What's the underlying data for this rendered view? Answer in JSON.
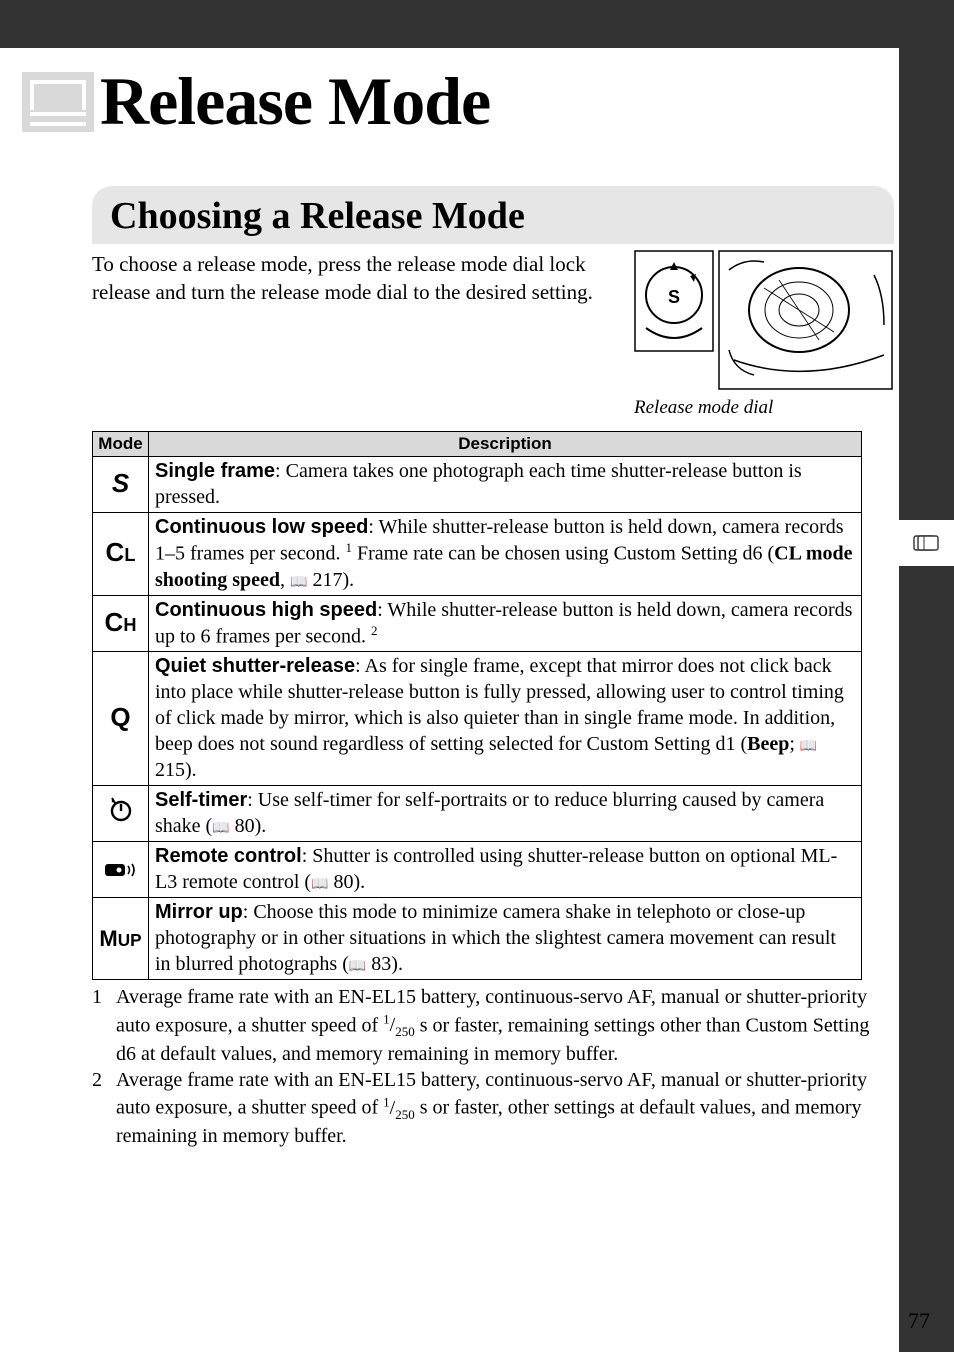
{
  "chapter": {
    "title": "Release Mode"
  },
  "section": {
    "heading": "Choosing a Release Mode"
  },
  "intro": "To choose a release mode, press the release mode dial lock release and turn the release mode dial to the desired setting.",
  "diagram_caption": "Release mode dial",
  "table": {
    "headers": {
      "mode": "Mode",
      "description": "Description"
    },
    "rows": [
      {
        "mode_label": "S",
        "mode_class": "mode-s",
        "desc_lead": "Single frame",
        "desc_rest": ": Camera takes one photograph each time shutter-release button is pressed."
      },
      {
        "mode_label": "CL",
        "mode_class": "mode-cl",
        "desc_lead": "Continuous low speed",
        "desc_rest_a": ": While shutter-release button is held down, camera records 1–5 frames per second.",
        "sup1": "1",
        "desc_rest_b": "  Frame rate can be chosen using Custom Setting d6 (",
        "bold_inline": "CL mode shooting speed",
        "desc_rest_c": ", ",
        "pageref": "217",
        "desc_rest_d": ")."
      },
      {
        "mode_label": "CH",
        "mode_class": "mode-ch",
        "desc_lead": "Continuous high speed",
        "desc_rest_a": ": While shutter-release button is held down, camera records up to 6 frames per second.",
        "sup2": "2"
      },
      {
        "mode_label": "Q",
        "mode_class": "mode-q",
        "desc_lead": "Quiet shutter-release",
        "desc_rest_a": ": As for single frame, except that mirror does not click back into place while shutter-release button is fully pressed, allowing user to control timing of click made by mirror, which is also quieter than in single frame mode.  In addition, beep does not sound regardless of setting selected for Custom Setting d1 (",
        "bold_inline": "Beep",
        "desc_rest_b": "; ",
        "pageref": "215",
        "desc_rest_c": ")."
      },
      {
        "mode_label": "timer",
        "desc_lead": "Self-timer",
        "desc_rest_a": ": Use self-timer for self-portraits or to reduce blurring caused by camera shake (",
        "pageref": "80",
        "desc_rest_b": ")."
      },
      {
        "mode_label": "remote",
        "desc_lead": "Remote control",
        "desc_rest_a": ": Shutter is controlled using shutter-release button on optional ML-L3 remote control (",
        "pageref": "80",
        "desc_rest_b": ")."
      },
      {
        "mode_label": "MUP",
        "mode_class": "mode-mup",
        "desc_lead": "Mirror up",
        "desc_rest_a": ": Choose this mode to minimize camera shake in telephoto or close-up photography or in other situations in which the slightest camera movement can result in blurred photographs (",
        "pageref": "83",
        "desc_rest_b": ")."
      }
    ]
  },
  "footnotes": {
    "f1_num": "1",
    "f1_a": "Average frame rate with an EN-EL15 battery, continuous-servo AF, manual or shutter-priority auto exposure, a shutter speed of ",
    "frac_num": "1",
    "frac_den": "250",
    "f1_b": " s or faster, remaining settings other than Custom Setting d6 at default values, and memory remaining in memory buffer.",
    "f2_num": "2",
    "f2_a": "Average frame rate with an EN-EL15 battery, continuous-servo AF, manual or shutter-priority auto exposure, a shutter speed of ",
    "f2_b": " s or faster, other settings at default values, and memory remaining in memory buffer."
  },
  "page_number": "77"
}
